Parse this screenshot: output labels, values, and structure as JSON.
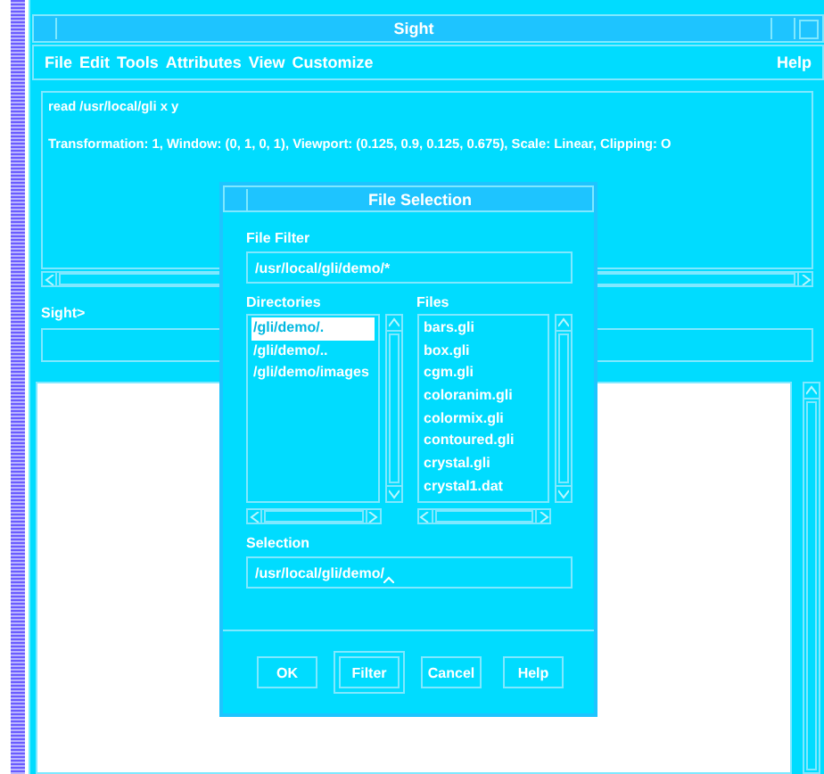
{
  "window": {
    "title": "Sight"
  },
  "menu": [
    {
      "label": "File"
    },
    {
      "label": "Edit"
    },
    {
      "label": "Tools"
    },
    {
      "label": "Attributes"
    },
    {
      "label": "View"
    },
    {
      "label": "Customize"
    }
  ],
  "help_menu": "Help",
  "output_lines": [
    "read /usr/local/gli x y",
    "Transformation: 1, Window: (0, 1, 0, 1), Viewport: (0.125, 0.9, 0.125, 0.675), Scale: Linear, Clipping: O"
  ],
  "prompt": {
    "label": "Sight>"
  },
  "dialog": {
    "title": "File Selection",
    "filter_label": "File Filter",
    "filter_value": "/usr/local/gli/demo/*",
    "directories_label": "Directories",
    "directories": [
      {
        "name": "/gli/demo/.",
        "selected": true
      },
      {
        "name": "/gli/demo/..",
        "selected": false
      },
      {
        "name": "/gli/demo/images",
        "selected": false
      }
    ],
    "files_label": "Files",
    "files": [
      {
        "name": "bars.gli",
        "selected": false
      },
      {
        "name": "box.gli",
        "selected": false
      },
      {
        "name": "cgm.gli",
        "selected": false
      },
      {
        "name": "coloranim.gli",
        "selected": false
      },
      {
        "name": "colormix.gli",
        "selected": false
      },
      {
        "name": "contoured.gli",
        "selected": false
      },
      {
        "name": "crystal.gli",
        "selected": false
      },
      {
        "name": "crystal1.dat",
        "selected": false
      }
    ],
    "selection_label": "Selection",
    "selection_value": "/usr/local/gli/demo/",
    "buttons": [
      {
        "label": "OK",
        "default": false
      },
      {
        "label": "Filter",
        "default": true
      },
      {
        "label": "Cancel",
        "default": false
      },
      {
        "label": "Help",
        "default": false
      }
    ]
  }
}
